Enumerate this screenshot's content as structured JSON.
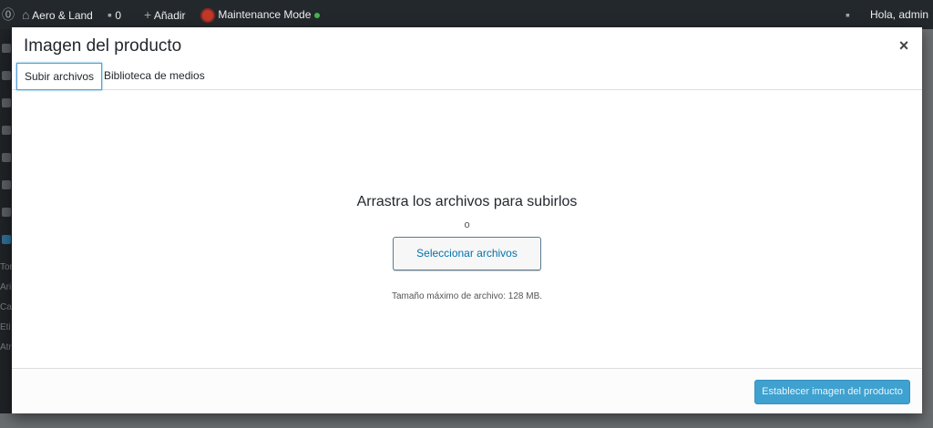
{
  "adminbar": {
    "site_name": "Aero & Land",
    "comments_count": "0",
    "new_label": "Añadir",
    "maintenance_label": "Maintenance Mode",
    "greeting": "Hola, admin"
  },
  "sidebar_bg": {
    "items": [
      "Tor",
      "Ari",
      "Ca",
      "Eti",
      "Atr"
    ]
  },
  "modal": {
    "title": "Imagen del producto",
    "close_label": "×",
    "tabs": [
      {
        "label": "Subir archivos",
        "active": true
      },
      {
        "label": "Biblioteca de medios",
        "active": false
      }
    ],
    "upload": {
      "drop_title": "Arrastra los archivos para subirlos",
      "or_text": "o",
      "select_button": "Seleccionar archivos",
      "max_size": "Tamaño máximo de archivo: 128 MB."
    },
    "toolbar": {
      "set_button": "Establecer imagen del producto"
    }
  },
  "colors": {
    "primary_button": "#3fa1cf",
    "admin_bar": "#23282d",
    "status_green": "#46b450"
  }
}
